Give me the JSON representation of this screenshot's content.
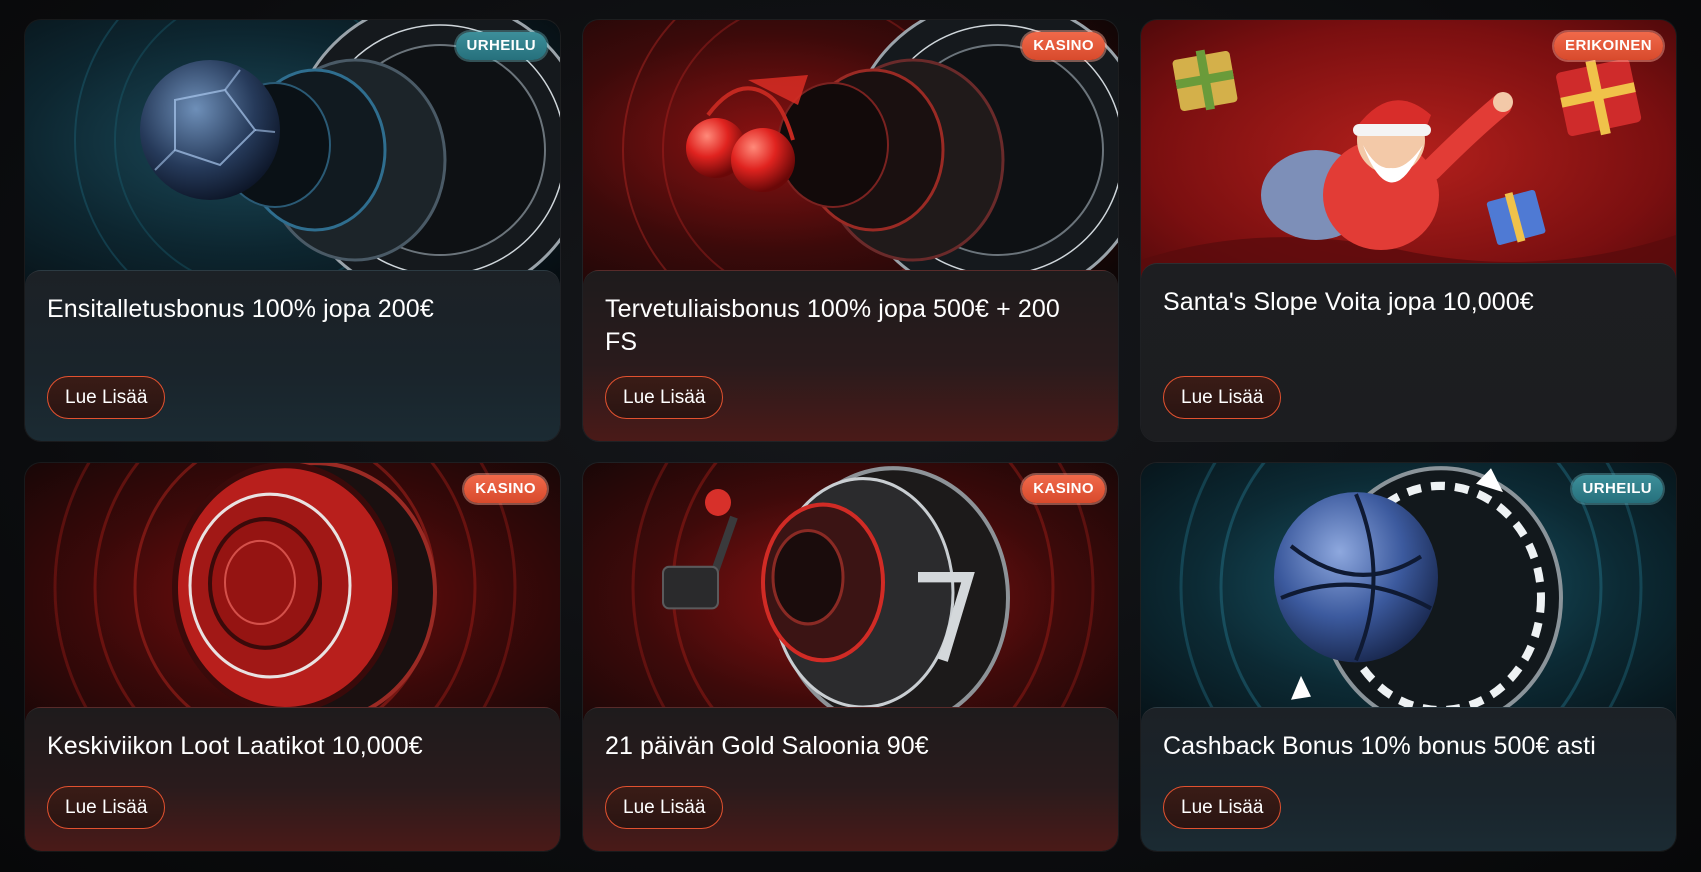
{
  "colors": {
    "accent": "#e2512f",
    "badge_sport": "#2f808b",
    "badge_casino": "#e35a3b",
    "background": "#0b0c0e"
  },
  "cards": [
    {
      "badge": "URHEILU",
      "title": "Ensitalletusbonus 100% jopa 200€",
      "button": "Lue Lisää",
      "art": "soccer-ball-roulette"
    },
    {
      "badge": "KASINO",
      "title": "Tervetuliaisbonus 100% jopa 500€ + 200 FS",
      "button": "Lue Lisää",
      "art": "cherries-roulette"
    },
    {
      "badge": "ERIKOINEN",
      "title": "Santa's Slope Voita jopa 10,000€",
      "button": "Lue Lisää",
      "art": "santa-with-gifts"
    },
    {
      "badge": "KASINO",
      "title": "Keskiviikon Loot Laatikot 10,000€",
      "button": "Lue Lisää",
      "art": "poker-chip"
    },
    {
      "badge": "KASINO",
      "title": "21 päivän Gold Saloonia 90€",
      "button": "Lue Lisää",
      "art": "slot-machine-reel"
    },
    {
      "badge": "URHEILU",
      "title": "Cashback Bonus 10% bonus 500€ asti",
      "button": "Lue Lisää",
      "art": "basketball-cashback"
    }
  ]
}
